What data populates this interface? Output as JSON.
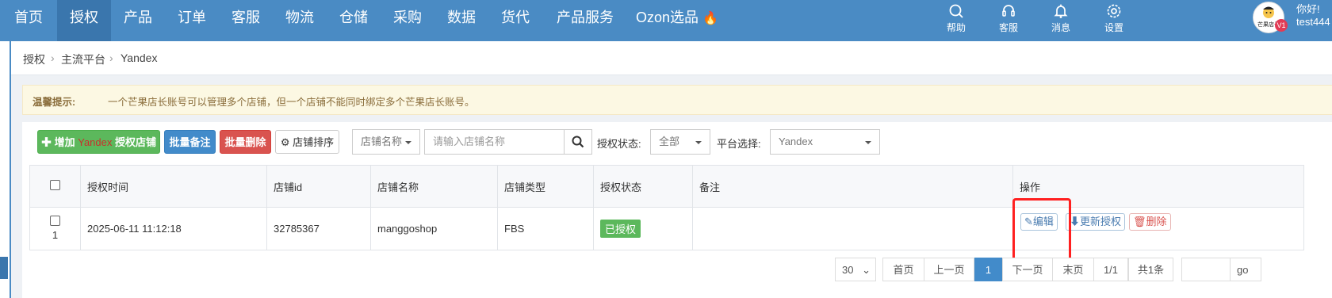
{
  "nav": {
    "items": [
      "首页",
      "授权",
      "产品",
      "订单",
      "客服",
      "物流",
      "仓储",
      "采购",
      "数据",
      "货代",
      "产品服务",
      "Ozon选品"
    ],
    "active_index": 1
  },
  "tools": {
    "help": "帮助",
    "service": "客服",
    "message": "消息",
    "settings": "设置"
  },
  "user": {
    "greeting": "你好!",
    "name": "test444",
    "vip_badge": "V1",
    "logo_text": "芒果店长"
  },
  "breadcrumb": {
    "items": [
      "授权",
      "主流平台",
      "Yandex"
    ]
  },
  "notice": {
    "label": "温馨提示:",
    "text": "一个芒果店长账号可以管理多个店铺，但一个店铺不能同时绑定多个芒果店长账号。"
  },
  "toolbar": {
    "add_prefix": "增加 ",
    "add_platform": "Yandex",
    "add_suffix": " 授权店铺",
    "batch_note": "批量备注",
    "batch_delete": "批量删除",
    "sort": "店铺排序",
    "store_field_select": "店铺名称",
    "store_search_placeholder": "请输入店铺名称",
    "auth_status_label": "授权状态:",
    "auth_status_value": "全部",
    "platform_label": "平台选择:",
    "platform_value": "Yandex"
  },
  "table": {
    "headers": [
      "授权时间",
      "店铺id",
      "店铺名称",
      "店铺类型",
      "授权状态",
      "备注",
      "操作"
    ],
    "rows": [
      {
        "index": "1",
        "time": "2025-06-11 11:12:18",
        "store_id": "32785367",
        "store_name": "manggoshop",
        "store_type": "FBS",
        "status": "已授权",
        "note": "",
        "edit": "编辑",
        "update": "更新授权",
        "delete": "删除"
      }
    ]
  },
  "pagination": {
    "page_size": "30",
    "first": "首页",
    "prev": "上一页",
    "current": "1",
    "next": "下一页",
    "last": "末页",
    "pages": "1/1",
    "total": "共1条",
    "go": "go"
  },
  "colors": {
    "topbar": "#4a8bc4",
    "highlight": "#ff2020",
    "success": "#5cb85c"
  }
}
